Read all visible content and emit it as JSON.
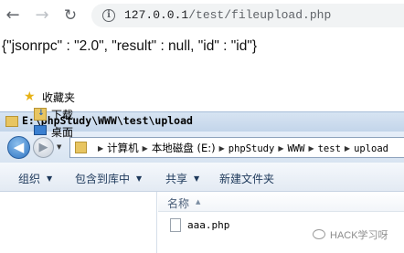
{
  "browser": {
    "url_host": "127.0.0.1",
    "url_path": "/test/fileupload.php",
    "back_glyph": "←",
    "forward_glyph": "→",
    "reload_glyph": "↻",
    "info_glyph": "i"
  },
  "page": {
    "json_output": "{\"jsonrpc\" : \"2.0\", \"result\" : null, \"id\" : \"id\"}"
  },
  "explorer": {
    "title": "E:\\phpStudy\\WWW\\test\\upload",
    "back_glyph": "◀",
    "forward_glyph": "▶",
    "forward_dropdown_glyph": "▼",
    "address_segments": [
      "计算机",
      "本地磁盘 (E:)",
      "phpStudy",
      "WWW",
      "test",
      "upload"
    ],
    "address_sep": "▶",
    "commands": {
      "organize": "组织",
      "include_in_library": "包含到库中",
      "share": "共享",
      "new_folder": "新建文件夹",
      "dropdown_glyph": "▼"
    },
    "nav_pane": {
      "favorites": "收藏夹",
      "downloads": "下载",
      "desktop": "桌面",
      "star_glyph": "★",
      "download_glyph": "↓"
    },
    "column_name": "名称",
    "sort_glyph": "▲",
    "files": [
      "aaa.php"
    ]
  },
  "watermark": {
    "text": "HACK学习呀"
  },
  "icons": {
    "back": "arrow-left-icon",
    "forward": "arrow-right-icon",
    "reload": "reload-icon",
    "info": "info-icon",
    "folder": "folder-icon",
    "star": "star-icon",
    "download": "download-folder-icon",
    "desktop": "desktop-icon",
    "file": "file-icon",
    "wechat": "wechat-icon"
  },
  "colors": {
    "title_bar": "#c3d5ea",
    "back_button": "#2e74c2",
    "command_text": "#1e395b",
    "folder": "#e8c561"
  }
}
